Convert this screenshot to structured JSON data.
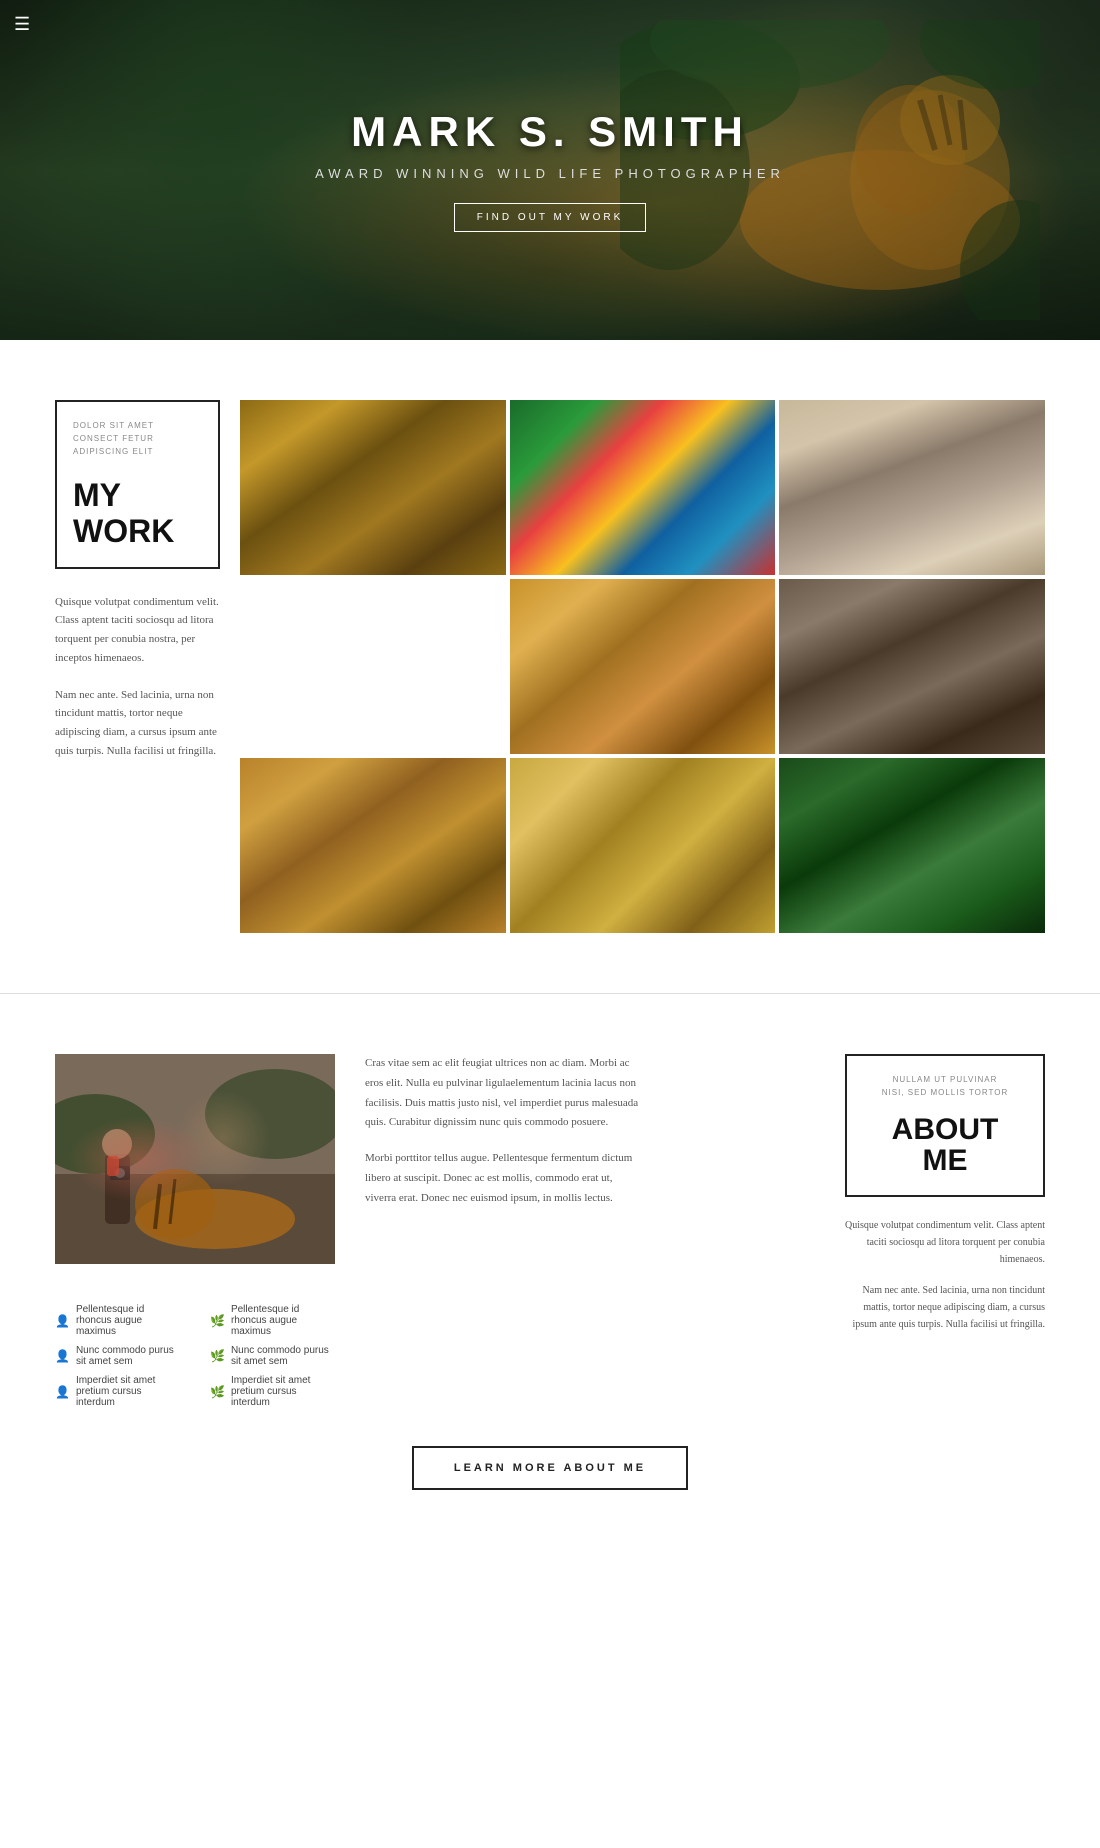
{
  "hero": {
    "hamburger": "☰",
    "name": "MARK S. SMITH",
    "subtitle": "AWARD WINNING WILD LIFE PHOTOGRAPHER",
    "btn_label": "FIND OUT MY WORK"
  },
  "work": {
    "label_subtitle": "DOLOR SIT AMET\nCONSECT FETUR\nADIPISCING ELIT",
    "label_title_line1": "MY",
    "label_title_line2": "WORK",
    "desc1": "Quisque volutpat condimentum velit. Class aptent taciti sociosqu ad litora torquent per conubia nostra, per inceptos himenaeos.",
    "desc2": "Nam nec ante. Sed lacinia, urna non tincidunt mattis, tortor neque adipiscing diam, a cursus ipsum ante quis turpis. Nulla facilisi ut fringilla."
  },
  "about": {
    "box_subtitle": "NULLAM UT PULVINAR\nNISI, SED MOLLIS TORTOR",
    "box_title_line1": "ABOUT",
    "box_title_line2": "ME",
    "text1": "Cras vitae sem ac elit feugiat ultrices non ac diam. Morbi ac eros elit. Nulla eu pulvinar ligulaelementum lacinia lacus non facilisis. Duis mattis justo nisl, vel imperdiet purus malesuada quis. Curabitur dignissim nunc quis commodo posuere.",
    "text2": "Morbi porttitor tellus augue. Pellentesque fermentum dictum libero at suscipit. Donec ac est mollis, commodo erat ut, viverra erat. Donec nec euismod ipsum, in mollis lectus.",
    "right_desc1": "Quisque volutpat condimentum velit. Class aptent taciti sociosqu ad litora torquent per conubia himenaeos.",
    "right_desc2": "Nam nec ante. Sed lacinia, urna non tincidunt mattis, tortor neque adipiscing diam, a cursus ipsum ante quis turpis. Nulla facilisi ut fringilla.",
    "list_left": [
      "Pellentesque id rhoncus augue maximus",
      "Nunc commodo purus sit amet sem",
      "Imperdiet sit amet pretium cursus interdum"
    ],
    "list_right": [
      "Pellentesque id rhoncus augue maximus",
      "Nunc commodo purus sit amet sem",
      "Imperdiet sit amet pretium cursus interdum"
    ],
    "learn_btn": "LEARN MORE ABOUT ME"
  }
}
